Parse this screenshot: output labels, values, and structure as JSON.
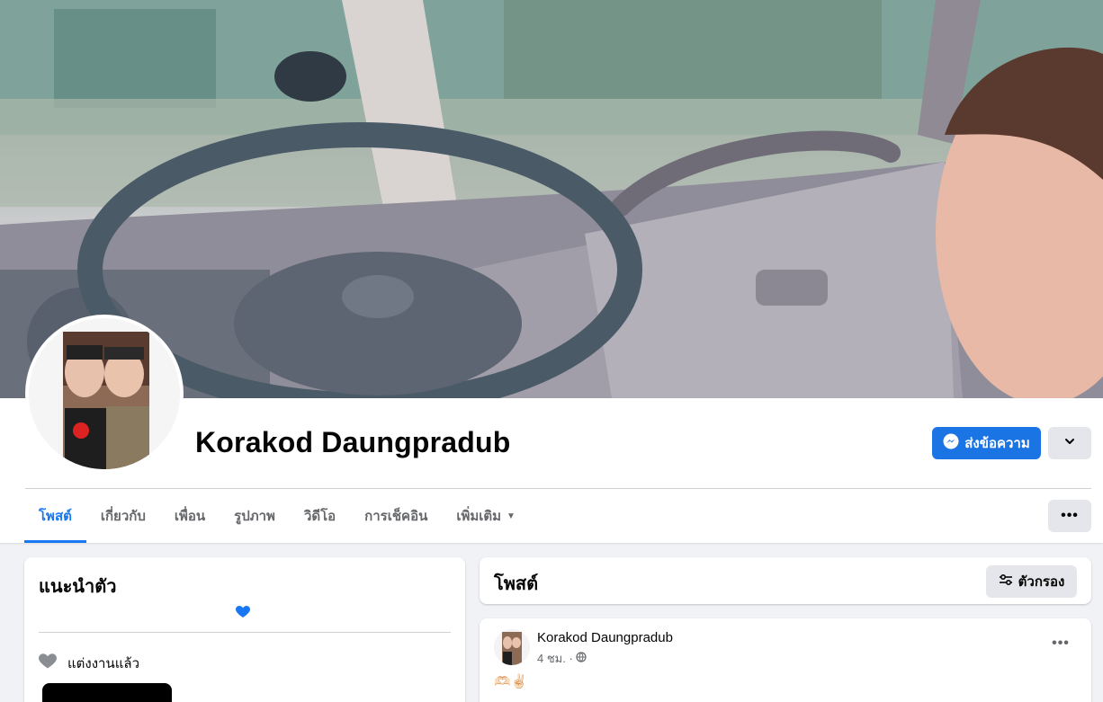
{
  "profile": {
    "name": "Korakod Daungpradub"
  },
  "actions": {
    "message_label": "ส่งข้อความ",
    "message_icon": "messenger-icon",
    "dropdown_icon": "chevron-down-icon"
  },
  "tabs": [
    {
      "label": "โพสต์",
      "active": true
    },
    {
      "label": "เกี่ยวกับ",
      "active": false
    },
    {
      "label": "เพื่อน",
      "active": false
    },
    {
      "label": "รูปภาพ",
      "active": false
    },
    {
      "label": "วิดีโอ",
      "active": false
    },
    {
      "label": "การเช็คอิน",
      "active": false
    },
    {
      "label": "เพิ่มเติม",
      "active": false
    }
  ],
  "intro": {
    "title": "แนะนำตัว",
    "relationship": "แต่งงานแล้ว"
  },
  "posts": {
    "title": "โพสต์",
    "filter_label": "ตัวกรอง"
  },
  "post": {
    "author": "Korakod Daungpradub",
    "time": "4 ชม. ·",
    "text": "🫶🏻✌🏻"
  },
  "colors": {
    "accent": "#1877f2",
    "button_primary": "#1b74e4",
    "button_secondary": "#e4e6eb",
    "page_bg": "#f0f2f5",
    "heart_blue": "#1877f2"
  }
}
